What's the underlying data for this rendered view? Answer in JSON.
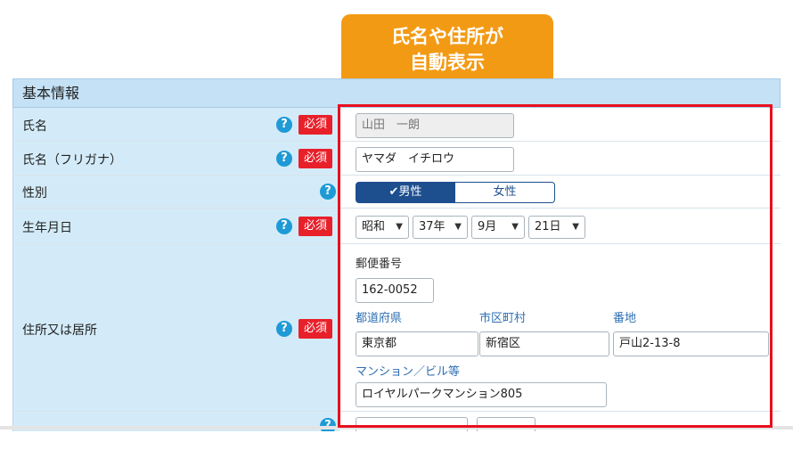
{
  "callout": {
    "line1": "氏名や住所が",
    "line2": "自動表示"
  },
  "section": {
    "title": "基本情報"
  },
  "required_label": "必須",
  "help_glyph": "?",
  "rows": {
    "name": {
      "label": "氏名",
      "value": "山田　一朗"
    },
    "kana": {
      "label": "氏名（フリガナ）",
      "value": "ヤマダ　イチロウ"
    },
    "gender": {
      "label": "性別",
      "options": [
        "✔男性",
        "女性"
      ],
      "selected": "男性"
    },
    "birth": {
      "label": "生年月日",
      "era": "昭和",
      "year": "37年",
      "month": "9月",
      "day": "21日"
    },
    "address": {
      "label": "住所又は居所",
      "postal_label": "郵便番号",
      "postal": "162-0052",
      "pref_label": "都道府県",
      "pref": "東京都",
      "city_label": "市区町村",
      "city": "新宿区",
      "street_label": "番地",
      "street": "戸山2-13-8",
      "building_label": "マンション／ビル等",
      "building": "ロイヤルパークマンション805"
    }
  },
  "colors": {
    "accent": "#1d4f8f",
    "required": "#e8202a",
    "callout": "#f39a14",
    "highlight": "#e8101e"
  }
}
